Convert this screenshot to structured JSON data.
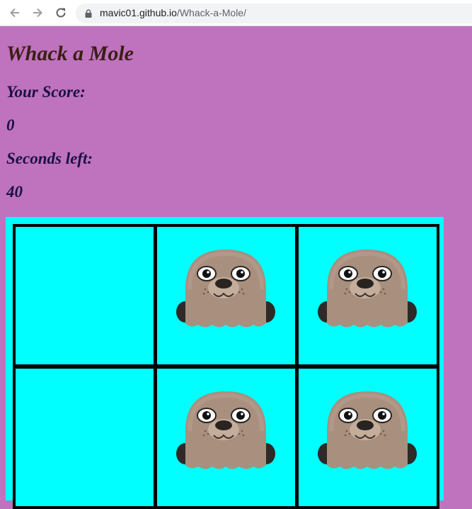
{
  "browser": {
    "url_host": "mavic01.github.io",
    "url_path": "/Whack-a-Mole/"
  },
  "game": {
    "title": "Whack a Mole",
    "score_label": "Your Score:",
    "score_value": "0",
    "time_label": "Seconds left:",
    "time_value": "40",
    "holes": [
      {
        "has_mole": false
      },
      {
        "has_mole": true
      },
      {
        "has_mole": true
      },
      {
        "has_mole": false
      },
      {
        "has_mole": true
      },
      {
        "has_mole": true
      }
    ]
  },
  "colors": {
    "page_background": "#bf72be",
    "board_background": "#00ffff",
    "cell_border": "#000000",
    "title_color": "#3a1f12",
    "text_color": "#1a1042"
  }
}
